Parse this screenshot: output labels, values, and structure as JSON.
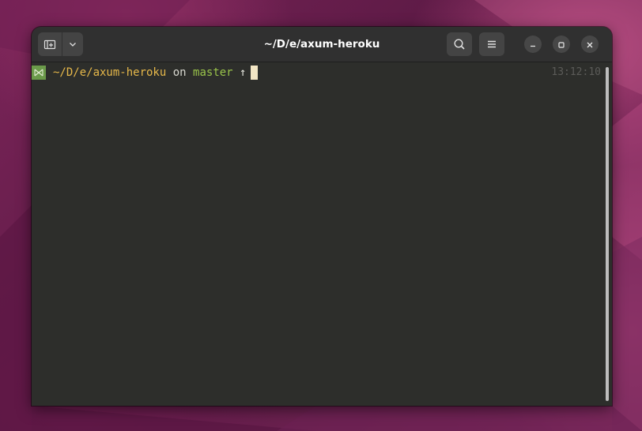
{
  "window": {
    "title": "~/D/e/axum-heroku"
  },
  "headerbar": {
    "new_tab_icon": "new-tab-icon",
    "tab_menu_icon": "chevron-down-icon",
    "search_icon": "search-icon",
    "menu_icon": "hamburger-menu-icon",
    "minimize_icon": "minimize-icon",
    "maximize_icon": "maximize-icon",
    "close_icon": "close-icon"
  },
  "terminal": {
    "prompt": {
      "status_icon": "success-cross-icon",
      "cwd": "~/D/e/axum-heroku",
      "on": "on",
      "branch": "master",
      "ahead_indicator": "↑"
    },
    "clock": "13:12:10"
  },
  "colors": {
    "cwd": "#e6b84a",
    "branch": "#9ac44a",
    "status_icon_bg": "#6b9a4a",
    "cursor": "#f2e6c4",
    "terminal_bg": "#2d2e2b"
  }
}
